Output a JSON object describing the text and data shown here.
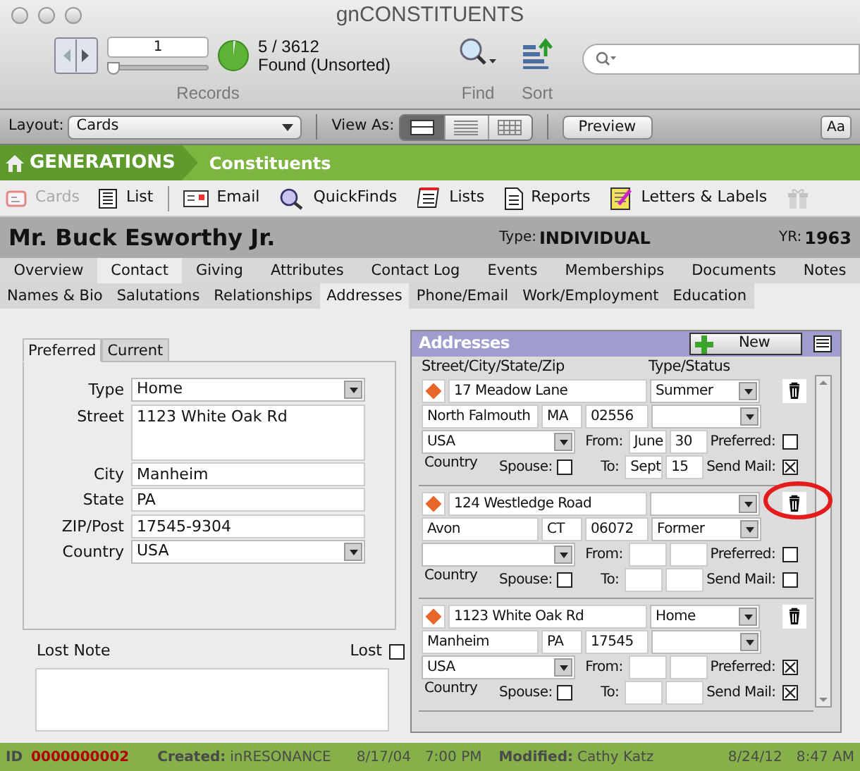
{
  "window": {
    "title": "gnCONSTITUENTS"
  },
  "toolbar": {
    "record_number": "1",
    "record_slider": {
      "level": 0
    },
    "records_label": "Records",
    "found_count": "5 / 3612",
    "found_status": "Found (Unsorted)",
    "find_label": "Find",
    "sort_label": "Sort"
  },
  "layout_bar": {
    "layout_label": "Layout:",
    "layout_value": "Cards",
    "view_as_label": "View As:",
    "view_modes": [
      {
        "kind": "form",
        "selected": true
      },
      {
        "kind": "list",
        "selected": false
      },
      {
        "kind": "table",
        "selected": false
      }
    ],
    "preview_button": "Preview",
    "text_size_button": "Aa"
  },
  "header": {
    "brand": "GENERATIONS",
    "section": "Constituents"
  },
  "nav": [
    {
      "kind": "cards",
      "label": "Cards",
      "disabled": true
    },
    {
      "kind": "list",
      "label": "List",
      "disabled": false
    },
    {
      "kind": "email",
      "label": "Email",
      "disabled": false
    },
    {
      "kind": "quickfinds",
      "label": "QuickFinds",
      "disabled": false
    },
    {
      "kind": "lists",
      "label": "Lists",
      "disabled": false
    },
    {
      "kind": "reports",
      "label": "Reports",
      "disabled": false
    },
    {
      "kind": "letters",
      "label": "Letters & Labels",
      "disabled": false
    },
    {
      "kind": "gift",
      "disabled": true
    }
  ],
  "record": {
    "name": "Mr. Buck Esworthy Jr.",
    "type_label": "Type:",
    "type": "INDIVIDUAL",
    "yr_label": "YR:",
    "yr": "1963"
  },
  "tabs": [
    {
      "label": "Overview",
      "selected": false
    },
    {
      "label": "Contact",
      "selected": true
    },
    {
      "label": "Giving",
      "selected": false
    },
    {
      "label": "Attributes",
      "selected": false
    },
    {
      "label": "Contact Log",
      "selected": false
    },
    {
      "label": "Events",
      "selected": false
    },
    {
      "label": "Memberships",
      "selected": false
    },
    {
      "label": "Documents",
      "selected": false
    },
    {
      "label": "Notes",
      "selected": false
    }
  ],
  "subtabs": [
    {
      "label": "Names & Bio",
      "selected": false
    },
    {
      "label": "Salutations",
      "selected": false
    },
    {
      "label": "Relationships",
      "selected": false
    },
    {
      "label": "Addresses",
      "selected": true
    },
    {
      "label": "Phone/Email",
      "selected": false
    },
    {
      "label": "Work/Employment",
      "selected": false
    },
    {
      "label": "Education",
      "selected": false
    }
  ],
  "preferred_address": {
    "tabs": [
      {
        "label": "Preferred",
        "selected": true
      },
      {
        "label": "Current",
        "selected": false
      }
    ],
    "fields": [
      {
        "kind": "select",
        "label": "Type",
        "value": "Home"
      },
      {
        "kind": "textarea",
        "label": "Street",
        "value": "1123 White Oak Rd"
      },
      {
        "kind": "text",
        "label": "City",
        "value": "Manheim"
      },
      {
        "kind": "text",
        "label": "State",
        "value": "PA"
      },
      {
        "kind": "text",
        "label": "ZIP/Post",
        "value": "17545-9304"
      },
      {
        "kind": "select",
        "label": "Country",
        "value": "USA"
      }
    ]
  },
  "lost": {
    "note_label": "Lost Note",
    "lost_label": "Lost",
    "checked": false
  },
  "addresses": {
    "title": "Addresses",
    "new_button": "New",
    "column_headers": [
      "Street/City/State/Zip",
      "Type/Status"
    ],
    "entries": [
      {
        "street": "17 Meadow Lane",
        "type": "Summer",
        "city": "North Falmouth",
        "state": "MA",
        "zip": "02556",
        "country": "USA",
        "country_label": "Country",
        "from_label": "From:",
        "from_month": "June",
        "from_day": "30",
        "to_label": "To:",
        "to_month": "Sept",
        "to_day": "15",
        "spouse_label": "Spouse:",
        "spouse": false,
        "preferred_label": "Preferred:",
        "preferred": false,
        "send_mail_label": "Send Mail:",
        "send_mail": true,
        "highlighted": false
      },
      {
        "street": "124 Westledge Road",
        "city": "Avon",
        "state": "CT",
        "zip": "06072",
        "status": "Former",
        "country_label": "Country",
        "from_label": "From:",
        "to_label": "To:",
        "spouse_label": "Spouse:",
        "spouse": false,
        "preferred_label": "Preferred:",
        "preferred": false,
        "send_mail_label": "Send Mail:",
        "send_mail": false,
        "highlighted": true
      },
      {
        "street": "1123 White Oak Rd",
        "type": "Home",
        "city": "Manheim",
        "state": "PA",
        "zip": "17545",
        "country": "USA",
        "country_label": "Country",
        "from_label": "From:",
        "to_label": "To:",
        "spouse_label": "Spouse:",
        "spouse": false,
        "preferred_label": "Preferred:",
        "preferred": true,
        "send_mail_label": "Send Mail:",
        "send_mail": true,
        "highlighted": false
      }
    ]
  },
  "status_bar": {
    "id_label": "ID",
    "id": "0000000002",
    "created_label": "Created:",
    "created_by": "inRESONANCE",
    "created_date": "8/17/04",
    "created_time": "7:00 PM",
    "modified_label": "Modified:",
    "modified_by": "Cathy Katz",
    "modified_date": "8/24/12",
    "modified_time": "8:47 AM"
  }
}
